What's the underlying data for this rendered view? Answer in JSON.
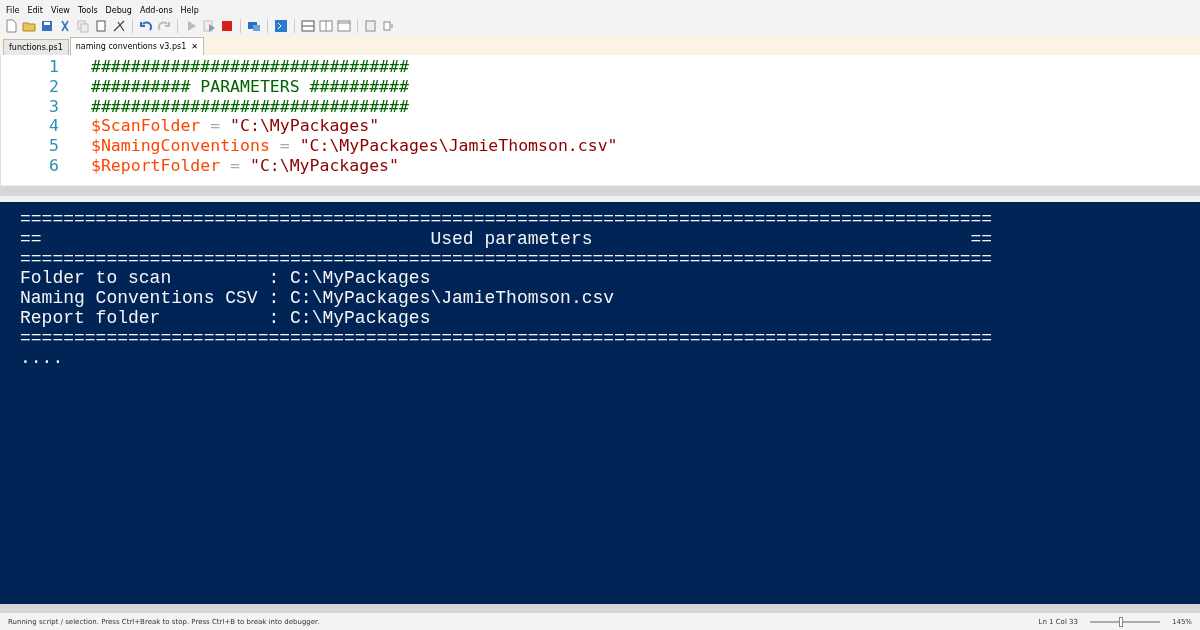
{
  "menu": [
    "File",
    "Edit",
    "View",
    "Tools",
    "Debug",
    "Add-ons",
    "Help"
  ],
  "tabs": [
    {
      "label": "functions.ps1",
      "selected": false
    },
    {
      "label": "naming conventions v3.ps1",
      "selected": true,
      "close": "✕"
    }
  ],
  "editor": {
    "lines": [
      {
        "number": "1",
        "tokens": [
          {
            "kind": "comment",
            "text": "################################"
          }
        ]
      },
      {
        "number": "2",
        "tokens": [
          {
            "kind": "comment",
            "text": "########## PARAMETERS ##########"
          }
        ]
      },
      {
        "number": "3",
        "tokens": [
          {
            "kind": "comment",
            "text": "################################"
          }
        ]
      },
      {
        "number": "4",
        "tokens": [
          {
            "kind": "variable",
            "text": "$ScanFolder"
          },
          {
            "kind": "operator",
            "text": " = "
          },
          {
            "kind": "string",
            "text": "\"C:\\MyPackages\""
          }
        ]
      },
      {
        "number": "5",
        "tokens": [
          {
            "kind": "variable",
            "text": "$NamingConventions"
          },
          {
            "kind": "operator",
            "text": " = "
          },
          {
            "kind": "string",
            "text": "\"C:\\MyPackages\\JamieThomson.csv\""
          }
        ]
      },
      {
        "number": "6",
        "tokens": [
          {
            "kind": "variable",
            "text": "$ReportFolder"
          },
          {
            "kind": "operator",
            "text": " = "
          },
          {
            "kind": "string",
            "text": "\"C:\\MyPackages\""
          }
        ]
      }
    ]
  },
  "console": {
    "lines": [
      "==========================================================================================",
      "==                                    Used parameters                                   ==",
      "==========================================================================================",
      "Folder to scan         : C:\\MyPackages",
      "Naming Conventions CSV : C:\\MyPackages\\JamieThomson.csv",
      "Report folder          : C:\\MyPackages",
      "==========================================================================================",
      "...."
    ]
  },
  "status_bar": {
    "message": "Running script / selection.  Press Ctrl+Break to stop.  Press Ctrl+B to break into debugger.",
    "position": "Ln 1  Col 33",
    "zoom_slider": {
      "level": 0.45
    },
    "zoom": "145%"
  }
}
